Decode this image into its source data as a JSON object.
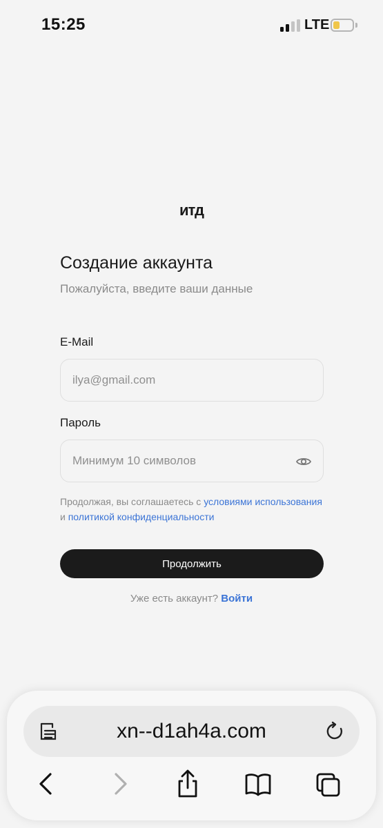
{
  "status_bar": {
    "time": "15:25",
    "network": "LTE",
    "signal_bars_active": 2,
    "battery_color": "#f0c64a"
  },
  "logo": {
    "text": "итд"
  },
  "form": {
    "title": "Создание аккаунта",
    "subtitle": "Пожалуйста, введите ваши данные",
    "email_label": "E-Mail",
    "email_placeholder": "ilya@gmail.com",
    "email_value": "",
    "password_label": "Пароль",
    "password_placeholder": "Минимум 10 символов",
    "password_value": "",
    "terms_prefix": "Продолжая, вы соглашаетесь с ",
    "terms_link": "условиями использования",
    "terms_and": " и ",
    "privacy_link": "политикой конфиденциальности",
    "continue_label": "Продолжить",
    "have_account": "Уже есть аккаунт? ",
    "login_link": "Войти"
  },
  "browser": {
    "url": "xn--d1ah4a.com",
    "icons": [
      "reader-mode-icon",
      "reload-icon",
      "back-icon",
      "forward-icon",
      "share-icon",
      "bookmarks-icon",
      "tabs-icon"
    ]
  },
  "colors": {
    "accent_link": "#3b74d6",
    "button_bg": "#1b1b1b",
    "background": "#f4f4f4"
  }
}
